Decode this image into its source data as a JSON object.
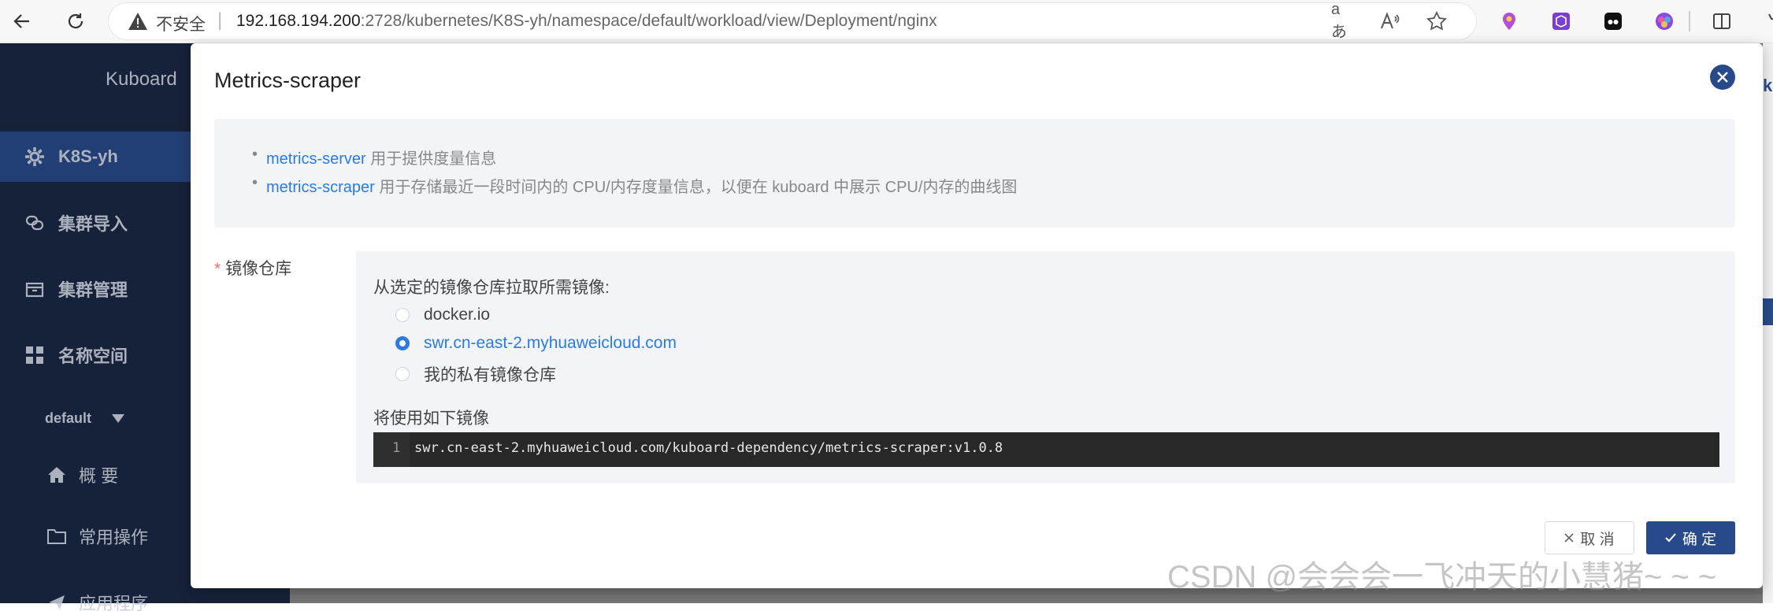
{
  "browser": {
    "insecure_label": "不安全",
    "url_host": "192.168.194.200",
    "url_rest": ":2728/kubernetes/K8S-yh/namespace/default/workload/view/Deployment/nginx",
    "read_aloud_label": "aあ",
    "text_size_label": "A⁾"
  },
  "sidebar": {
    "brand": "Kuboard",
    "cluster": "K8S-yh",
    "items": [
      {
        "label": "集群导入"
      },
      {
        "label": "集群管理"
      },
      {
        "label": "名称空间"
      }
    ],
    "namespace": "default",
    "sub_items": [
      {
        "label": "概 要"
      },
      {
        "label": "常用操作"
      },
      {
        "label": "应用程序"
      }
    ]
  },
  "dialog": {
    "title": "Metrics-scraper",
    "info": [
      {
        "link": "metrics-server",
        "text": " 用于提供度量信息"
      },
      {
        "link": "metrics-scraper",
        "text": " 用于存储最近一段时间内的 CPU/内存度量信息，以便在 kuboard 中展示 CPU/内存的曲线图"
      }
    ],
    "field_label": "镜像仓库",
    "pull_text": "从选定的镜像仓库拉取所需镜像:",
    "options": [
      {
        "label": "docker.io",
        "selected": false
      },
      {
        "label": "swr.cn-east-2.myhuaweicloud.com",
        "selected": true
      },
      {
        "label": "我的私有镜像仓库",
        "selected": false
      }
    ],
    "use_text": "将使用如下镜像",
    "code_line_number": "1",
    "code_text": "swr.cn-east-2.myhuaweicloud.com/kuboard-dependency/metrics-scraper:v1.0.8",
    "cancel_label": "取 消",
    "ok_label": "确 定"
  },
  "right_edge_label": "k",
  "watermark": "CSDN @会会会一飞冲天的小慧猪~ ~ ~",
  "colors": {
    "primary": "#294a8a",
    "link": "#2a7be2",
    "sidebar_bg": "#1a2745"
  }
}
